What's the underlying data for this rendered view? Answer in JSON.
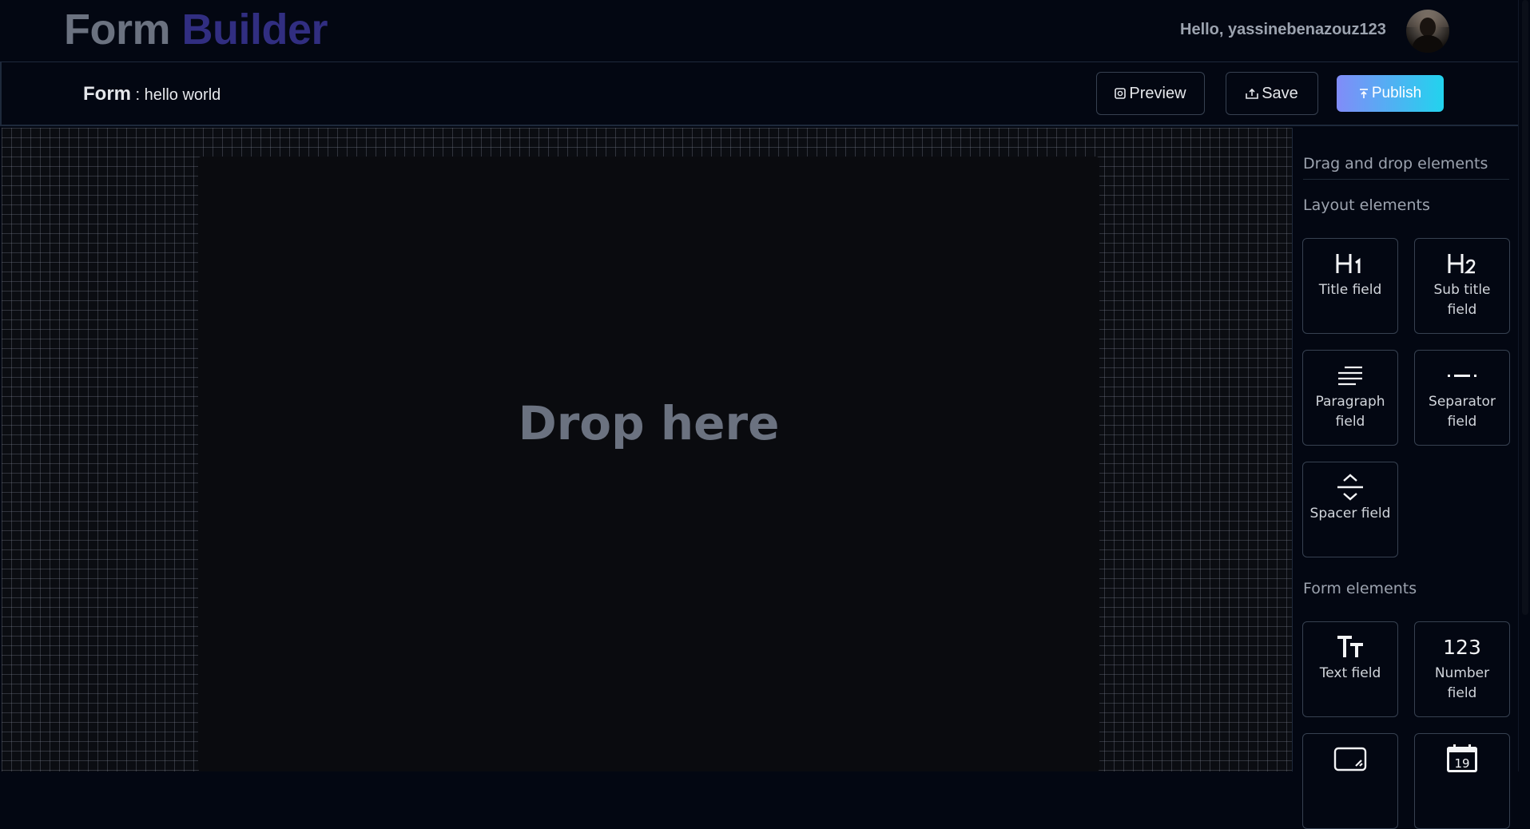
{
  "header": {
    "logo_part1": "Form",
    "logo_part2": "Builder",
    "greeting": "Hello, yassinebenazouz123",
    "avatar_icon": "user-avatar-photo"
  },
  "formbar": {
    "form_label": "Form",
    "separator": " : ",
    "form_name": "hello world",
    "preview_label": "Preview",
    "save_label": "Save",
    "publish_label": "Publish",
    "publish_gradient": [
      "#818cf8",
      "#22d3ee"
    ]
  },
  "canvas": {
    "drop_text": "Drop here"
  },
  "sidebar": {
    "heading": "Drag and drop elements",
    "layout_section": "Layout elements",
    "layout_items": [
      {
        "label": "Title field",
        "icon": "heading-1-icon"
      },
      {
        "label": "Sub title field",
        "icon": "heading-2-icon"
      },
      {
        "label": "Paragraph field",
        "icon": "paragraph-icon"
      },
      {
        "label": "Separator field",
        "icon": "separator-icon"
      },
      {
        "label": "Spacer field",
        "icon": "spacer-icon"
      }
    ],
    "form_section": "Form elements",
    "form_items": [
      {
        "label": "Text field",
        "icon": "text-icon"
      },
      {
        "label": "Number field",
        "icon": "number-icon",
        "icon_text": "123"
      },
      {
        "label": "",
        "icon": "textarea-icon"
      },
      {
        "label": "",
        "icon": "calendar-icon",
        "icon_text": "19"
      }
    ]
  }
}
